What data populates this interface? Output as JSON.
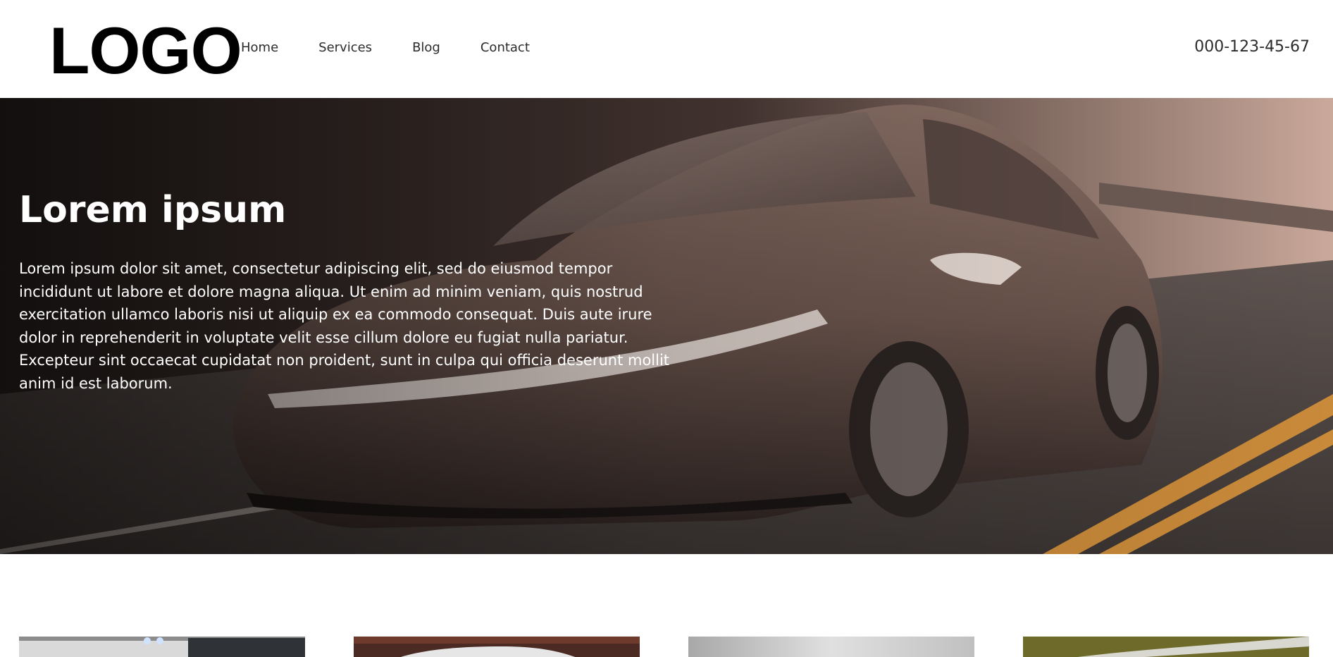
{
  "header": {
    "logo": "LOGO",
    "nav": [
      {
        "label": "Home"
      },
      {
        "label": "Services"
      },
      {
        "label": "Blog"
      },
      {
        "label": "Contact"
      }
    ],
    "phone": "000-123-45-67"
  },
  "hero": {
    "title": "Lorem ipsum",
    "text": "Lorem ipsum dolor sit amet, consectetur adipiscing elit, sed do eiusmod tempor incididunt ut labore et dolore magna aliqua. Ut enim ad minim veniam, quis nostrud exercitation ullamco laboris nisi ut aliquip ex ea commodo consequat. Duis aute irure dolor in reprehenderit in voluptate velit esse cillum dolore eu fugiat nulla pariatur. Excepteur sint occaecat cupidatat non proident, sunt in culpa qui officia deserunt mollit anim id est laborum.",
    "image": "car-photo"
  },
  "cards": [
    {
      "image": "showroom-photo"
    },
    {
      "image": "car-front-photo"
    },
    {
      "image": "grey-car-photo"
    },
    {
      "image": "race-track-photo"
    }
  ]
}
